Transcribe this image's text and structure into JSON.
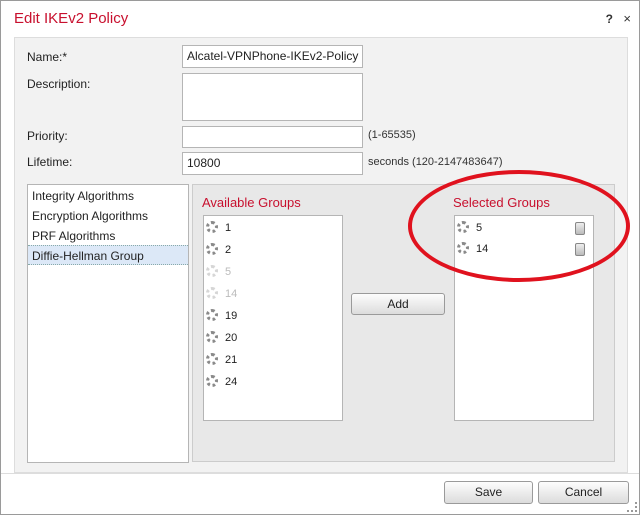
{
  "dialog": {
    "title": "Edit IKEv2 Policy",
    "help_label": "?",
    "close_label": "×"
  },
  "form": {
    "name_label": "Name:*",
    "name_value": "Alcatel-VPNPhone-IKEv2-Policy",
    "description_label": "Description:",
    "description_value": "",
    "priority_label": "Priority:",
    "priority_value": "",
    "priority_hint": "(1-65535)",
    "lifetime_label": "Lifetime:",
    "lifetime_value": "10800",
    "lifetime_hint": "seconds (120-2147483647)"
  },
  "nav": {
    "items": [
      {
        "label": "Integrity Algorithms",
        "selected": false
      },
      {
        "label": "Encryption Algorithms",
        "selected": false
      },
      {
        "label": "PRF Algorithms",
        "selected": false
      },
      {
        "label": "Diffie-Hellman Group",
        "selected": true
      }
    ]
  },
  "available": {
    "heading": "Available Groups",
    "items": [
      {
        "label": "1",
        "disabled": false
      },
      {
        "label": "2",
        "disabled": false
      },
      {
        "label": "5",
        "disabled": true
      },
      {
        "label": "14",
        "disabled": true
      },
      {
        "label": "19",
        "disabled": false
      },
      {
        "label": "20",
        "disabled": false
      },
      {
        "label": "21",
        "disabled": false
      },
      {
        "label": "24",
        "disabled": false
      }
    ]
  },
  "add_label": "Add",
  "selected": {
    "heading": "Selected Groups",
    "items": [
      {
        "label": "5"
      },
      {
        "label": "14"
      }
    ]
  },
  "footer": {
    "save_label": "Save",
    "cancel_label": "Cancel"
  },
  "colors": {
    "accent_red": "#c8102e",
    "annotation_circle": "#e0121e"
  }
}
